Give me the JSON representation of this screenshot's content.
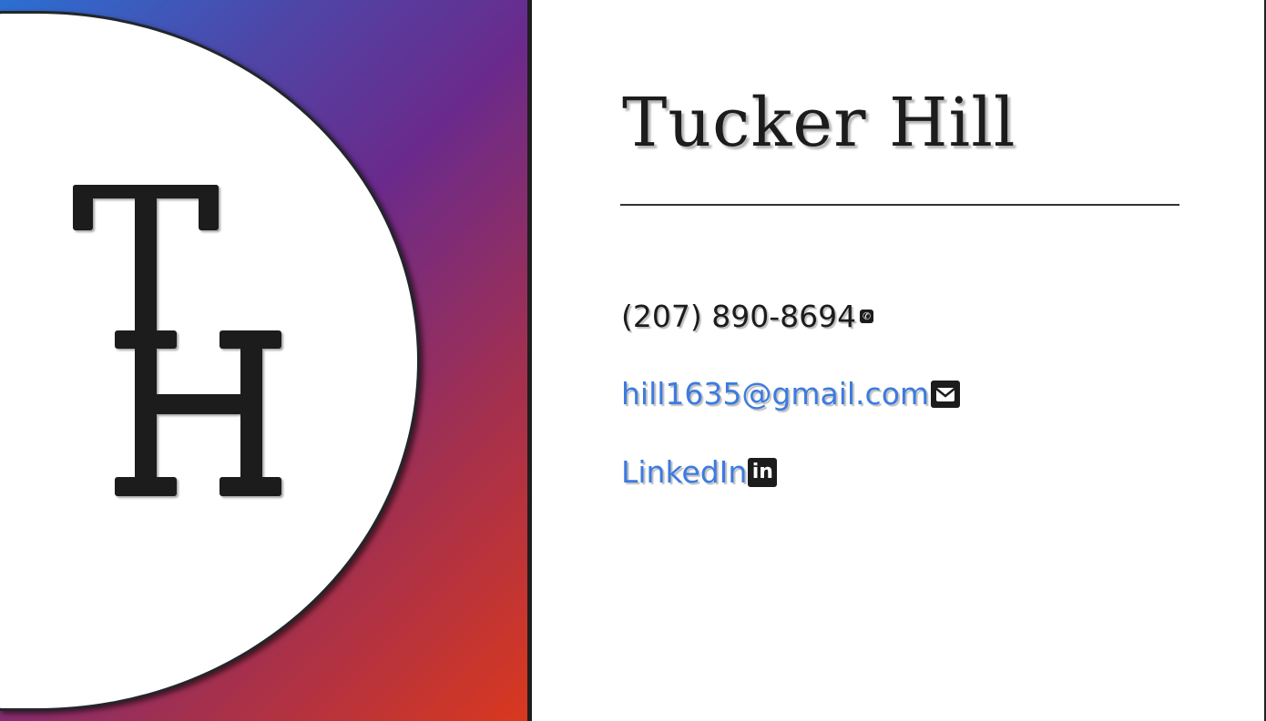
{
  "logo": {
    "monogram": "TH"
  },
  "profile": {
    "name": "Tucker Hill",
    "phone": "(207) 890-8694",
    "email": "hill1635@gmail.com",
    "linkedin_label": "LinkedIn",
    "linkedin_icon_text": "in"
  },
  "colors": {
    "link": "#3c7be0",
    "text": "#1c1c1c",
    "gradient_start": "#2b6fd2",
    "gradient_mid": "#6a2a8c",
    "gradient_end": "#d9381e"
  },
  "icons": {
    "phone": "phone-icon",
    "email": "envelope-icon",
    "linkedin": "linkedin-icon"
  }
}
